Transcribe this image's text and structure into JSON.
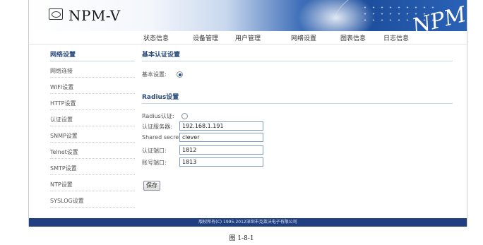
{
  "brand": {
    "name": "NPM-V",
    "banner_text": "NPM"
  },
  "nav": [
    "状态信息",
    "设备管理",
    "用户管理",
    "网络设置",
    "图表信息",
    "日志信息"
  ],
  "sidebar": {
    "title": "网络设置",
    "items": [
      "网络连接",
      "WIFI设置",
      "HTTP设置",
      "认证设置",
      "SNMP设置",
      "Telnet设置",
      "SMTP设置",
      "NTP设置",
      "SYSLOG设置"
    ]
  },
  "basic_auth": {
    "section_title": "基本认证设置",
    "label": "基本设置:",
    "enabled": true
  },
  "radius": {
    "section_title": "Radius设置",
    "auth_label": "Radius认证:",
    "auth_enabled": false,
    "server_label": "认证服务器:",
    "server_value": "192.168.1.191",
    "secret_label": "Shared secret:",
    "secret_value": "clever",
    "auth_port_label": "认证端口:",
    "auth_port_value": "1812",
    "acct_port_label": "账号端口:",
    "acct_port_value": "1813"
  },
  "save_button": "保存",
  "footer": "版权所有(C) 1995-2012深圳市克莱沃电子有限公司",
  "caption": "图 1-8-1",
  "colors": {
    "accent": "#2b4c7e",
    "footer_bg": "#1f3f80",
    "banner_blue": "#1e4f9e"
  }
}
